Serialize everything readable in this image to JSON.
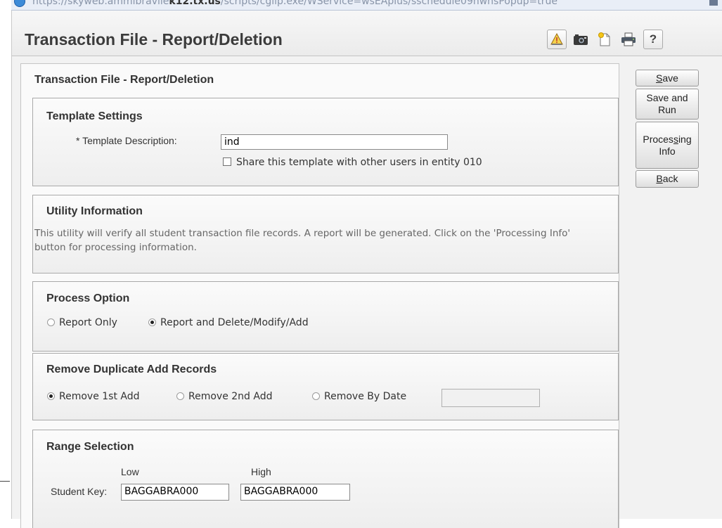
{
  "browser": {
    "url_prefix": "https://skyweb.ammibravlle",
    "url_bold": "k12.tx.us",
    "url_rest": "/scripts/cgiip.exe/WService=wsEAplus/sschedule09hwhsPopup=true"
  },
  "header": {
    "title": "Transaction File - Report/Deletion"
  },
  "main": {
    "heading": "Transaction File - Report/Deletion"
  },
  "template_settings": {
    "title": "Template Settings",
    "description_label": "* Template Description:",
    "description_value": "ind",
    "share_label": "Share this template with other users in entity 010",
    "share_checked": false
  },
  "utility_info": {
    "title": "Utility Information",
    "text": "This utility will verify all student transaction file records. A report will be generated. Click on the 'Processing Info' button for processing information."
  },
  "process_option": {
    "title": "Process Option",
    "options": [
      "Report Only",
      "Report and Delete/Modify/Add"
    ],
    "selected": "Report and Delete/Modify/Add"
  },
  "remove_duplicates": {
    "title": "Remove Duplicate Add Records",
    "options": [
      "Remove 1st Add",
      "Remove 2nd Add",
      "Remove By Date"
    ],
    "selected": "Remove 1st Add",
    "date_value": ""
  },
  "range_selection": {
    "title": "Range Selection",
    "low_label": "Low",
    "high_label": "High",
    "field_label": "Student Key:",
    "low_value": "BAGGABRA000",
    "high_value": "BAGGABRA000"
  },
  "buttons": {
    "save_key": "S",
    "save_rest": "ave",
    "save_run_line1": "Save and",
    "save_run_line2": "Run",
    "processing_line1_pre": "Proces",
    "processing_line1_key": "s",
    "processing_line1_post": "ing",
    "processing_line2": "Info",
    "back_key": "B",
    "back_rest": "ack"
  },
  "toolbar_icons": [
    "alert-icon",
    "camera-icon",
    "new-note-icon",
    "print-icon",
    "help-icon"
  ],
  "help_glyph": "?"
}
